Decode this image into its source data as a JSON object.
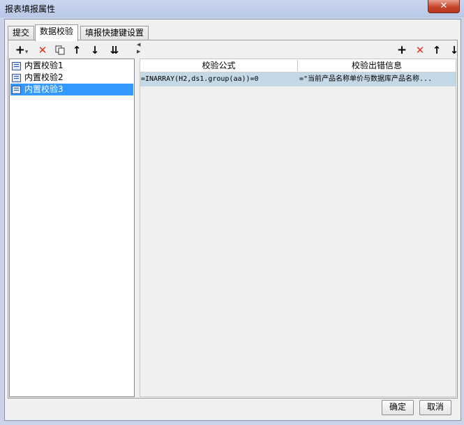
{
  "window": {
    "title": "报表填报属性",
    "close_glyph": "✕"
  },
  "tabs": [
    {
      "label": "提交"
    },
    {
      "label": "数据校验"
    },
    {
      "label": "填报快捷键设置"
    }
  ],
  "left_toolbar": {
    "add_icon": "plus-icon",
    "delete_icon": "delete-icon",
    "copy_icon": "copy-icon",
    "up_icon": "move-up-icon",
    "down_icon": "move-down-icon",
    "sort_icon": "sort-icon",
    "add_glyph": "+",
    "dropdown_glyph": "▾",
    "delete_glyph": "✕",
    "up_glyph": "↑",
    "down_glyph": "↓",
    "sort_glyph": "⇊"
  },
  "validations": [
    {
      "label": "内置校验1",
      "selected": false
    },
    {
      "label": "内置校验2",
      "selected": false
    },
    {
      "label": "内置校验3",
      "selected": true
    }
  ],
  "right_toolbar": {
    "add_glyph": "+",
    "delete_glyph": "✕",
    "up_glyph": "↑",
    "down_glyph": "↓"
  },
  "grid": {
    "columns": [
      "校验公式",
      "校验出错信息"
    ],
    "rows": [
      {
        "formula": "=INARRAY(H2,ds1.group(aa))=0",
        "message": "=\"当前产品名称单价与数据库产品名称..."
      }
    ]
  },
  "footer": {
    "ok_label": "确定",
    "cancel_label": "取消"
  },
  "colors": {
    "selection": "#3399ff",
    "row_highlight": "#c5d8e6",
    "delete_red": "#e03020"
  }
}
